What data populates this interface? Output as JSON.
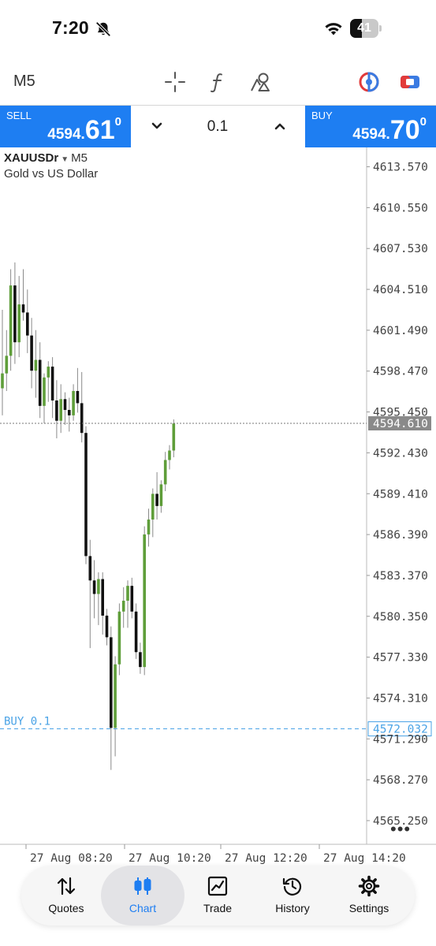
{
  "status_bar": {
    "time": "7:20",
    "battery": "41",
    "battery_level": 0.41
  },
  "toolbar": {
    "timeframe": "M5",
    "icons": [
      "crosshair-icon",
      "function-icon",
      "objects-icon",
      "color-theme-icon",
      "one-click-trading-icon"
    ]
  },
  "trade": {
    "sell": {
      "label": "SELL",
      "price_prefix": "4594.",
      "price_big": "61",
      "price_sup": "0"
    },
    "buy": {
      "label": "BUY",
      "price_prefix": "4594.",
      "price_big": "70",
      "price_sup": "0"
    },
    "volume": "0.1"
  },
  "chart": {
    "symbol": "XAUUSDr",
    "timeframe": "M5",
    "description": "Gold vs US Dollar",
    "price_labels": [
      "4613.570",
      "4610.550",
      "4607.530",
      "4604.510",
      "4601.490",
      "4598.470",
      "4595.450",
      "4592.430",
      "4589.410",
      "4586.390",
      "4583.370",
      "4580.350",
      "4577.330",
      "4574.310",
      "4571.290",
      "4568.270",
      "4565.250"
    ],
    "current_price": "4594.610",
    "position": {
      "label": "BUY 0.1",
      "price": "4572.032"
    },
    "time_labels": [
      "27 Aug 08:20",
      "27 Aug 10:20",
      "27 Aug 12:20",
      "27 Aug 14:20"
    ],
    "colors": {
      "bull": "#5f9e3a",
      "bear": "#111111",
      "current_line": "#777777",
      "position_line": "#4aa3e6",
      "current_tag": "#8a8a8a"
    }
  },
  "chart_data": {
    "type": "candlestick",
    "y_range": [
      4563.5,
      4615.0
    ],
    "x_range": [
      0,
      74
    ],
    "candles": [
      {
        "o": 4597.2,
        "h": 4603.0,
        "l": 4595.2,
        "c": 4598.3
      },
      {
        "o": 4598.3,
        "h": 4601.5,
        "l": 4597.0,
        "c": 4599.6
      },
      {
        "o": 4599.6,
        "h": 4606.0,
        "l": 4598.5,
        "c": 4604.8
      },
      {
        "o": 4604.8,
        "h": 4606.5,
        "l": 4599.0,
        "c": 4600.6
      },
      {
        "o": 4600.6,
        "h": 4605.5,
        "l": 4599.5,
        "c": 4603.4
      },
      {
        "o": 4603.4,
        "h": 4606.0,
        "l": 4602.2,
        "c": 4602.8
      },
      {
        "o": 4602.8,
        "h": 4604.5,
        "l": 4599.8,
        "c": 4601.1
      },
      {
        "o": 4601.1,
        "h": 4602.4,
        "l": 4597.2,
        "c": 4598.5
      },
      {
        "o": 4598.5,
        "h": 4601.5,
        "l": 4596.5,
        "c": 4599.3
      },
      {
        "o": 4599.3,
        "h": 4600.6,
        "l": 4595.0,
        "c": 4595.9
      },
      {
        "o": 4595.9,
        "h": 4598.3,
        "l": 4594.6,
        "c": 4598.0
      },
      {
        "o": 4598.0,
        "h": 4599.2,
        "l": 4596.2,
        "c": 4598.8
      },
      {
        "o": 4598.8,
        "h": 4599.5,
        "l": 4595.0,
        "c": 4596.3
      },
      {
        "o": 4596.3,
        "h": 4597.8,
        "l": 4593.5,
        "c": 4594.8
      },
      {
        "o": 4594.8,
        "h": 4597.5,
        "l": 4593.9,
        "c": 4596.4
      },
      {
        "o": 4596.4,
        "h": 4596.9,
        "l": 4594.5,
        "c": 4595.6
      },
      {
        "o": 4595.6,
        "h": 4596.5,
        "l": 4594.0,
        "c": 4595.2
      },
      {
        "o": 4595.2,
        "h": 4597.5,
        "l": 4594.8,
        "c": 4597.0
      },
      {
        "o": 4597.0,
        "h": 4598.7,
        "l": 4595.4,
        "c": 4596.1
      },
      {
        "o": 4596.1,
        "h": 4598.4,
        "l": 4593.2,
        "c": 4593.9
      },
      {
        "o": 4593.9,
        "h": 4594.4,
        "l": 4584.2,
        "c": 4584.8
      },
      {
        "o": 4584.8,
        "h": 4586.0,
        "l": 4578.0,
        "c": 4583.0
      },
      {
        "o": 4583.0,
        "h": 4584.5,
        "l": 4580.2,
        "c": 4582.0
      },
      {
        "o": 4582.0,
        "h": 4583.6,
        "l": 4579.7,
        "c": 4583.1
      },
      {
        "o": 4583.1,
        "h": 4583.6,
        "l": 4579.0,
        "c": 4580.4
      },
      {
        "o": 4580.4,
        "h": 4580.9,
        "l": 4578.2,
        "c": 4578.8
      },
      {
        "o": 4578.8,
        "h": 4579.6,
        "l": 4569.0,
        "c": 4572.1
      },
      {
        "o": 4572.1,
        "h": 4577.4,
        "l": 4570.0,
        "c": 4576.8
      },
      {
        "o": 4576.8,
        "h": 4581.3,
        "l": 4576.0,
        "c": 4580.7
      },
      {
        "o": 4580.7,
        "h": 4582.5,
        "l": 4579.5,
        "c": 4581.5
      },
      {
        "o": 4581.5,
        "h": 4583.0,
        "l": 4579.5,
        "c": 4582.6
      },
      {
        "o": 4582.6,
        "h": 4583.2,
        "l": 4580.2,
        "c": 4580.7
      },
      {
        "o": 4580.7,
        "h": 4581.3,
        "l": 4577.2,
        "c": 4577.7
      },
      {
        "o": 4577.7,
        "h": 4578.4,
        "l": 4576.1,
        "c": 4576.6
      },
      {
        "o": 4576.6,
        "h": 4587.0,
        "l": 4576.0,
        "c": 4586.4
      },
      {
        "o": 4586.4,
        "h": 4588.3,
        "l": 4585.5,
        "c": 4587.5
      },
      {
        "o": 4587.5,
        "h": 4589.8,
        "l": 4586.2,
        "c": 4589.4
      },
      {
        "o": 4589.4,
        "h": 4591.0,
        "l": 4587.5,
        "c": 4588.5
      },
      {
        "o": 4588.5,
        "h": 4590.4,
        "l": 4588.0,
        "c": 4590.1
      },
      {
        "o": 4590.1,
        "h": 4592.5,
        "l": 4589.6,
        "c": 4591.9
      },
      {
        "o": 4591.9,
        "h": 4593.0,
        "l": 4591.2,
        "c": 4592.6
      },
      {
        "o": 4592.6,
        "h": 4594.9,
        "l": 4592.1,
        "c": 4594.6
      }
    ]
  },
  "nav": {
    "items": [
      {
        "label": "Quotes",
        "icon": "quotes-icon"
      },
      {
        "label": "Chart",
        "icon": "chart-icon"
      },
      {
        "label": "Trade",
        "icon": "trade-icon"
      },
      {
        "label": "History",
        "icon": "history-icon"
      },
      {
        "label": "Settings",
        "icon": "settings-icon"
      }
    ],
    "active": "Chart"
  }
}
